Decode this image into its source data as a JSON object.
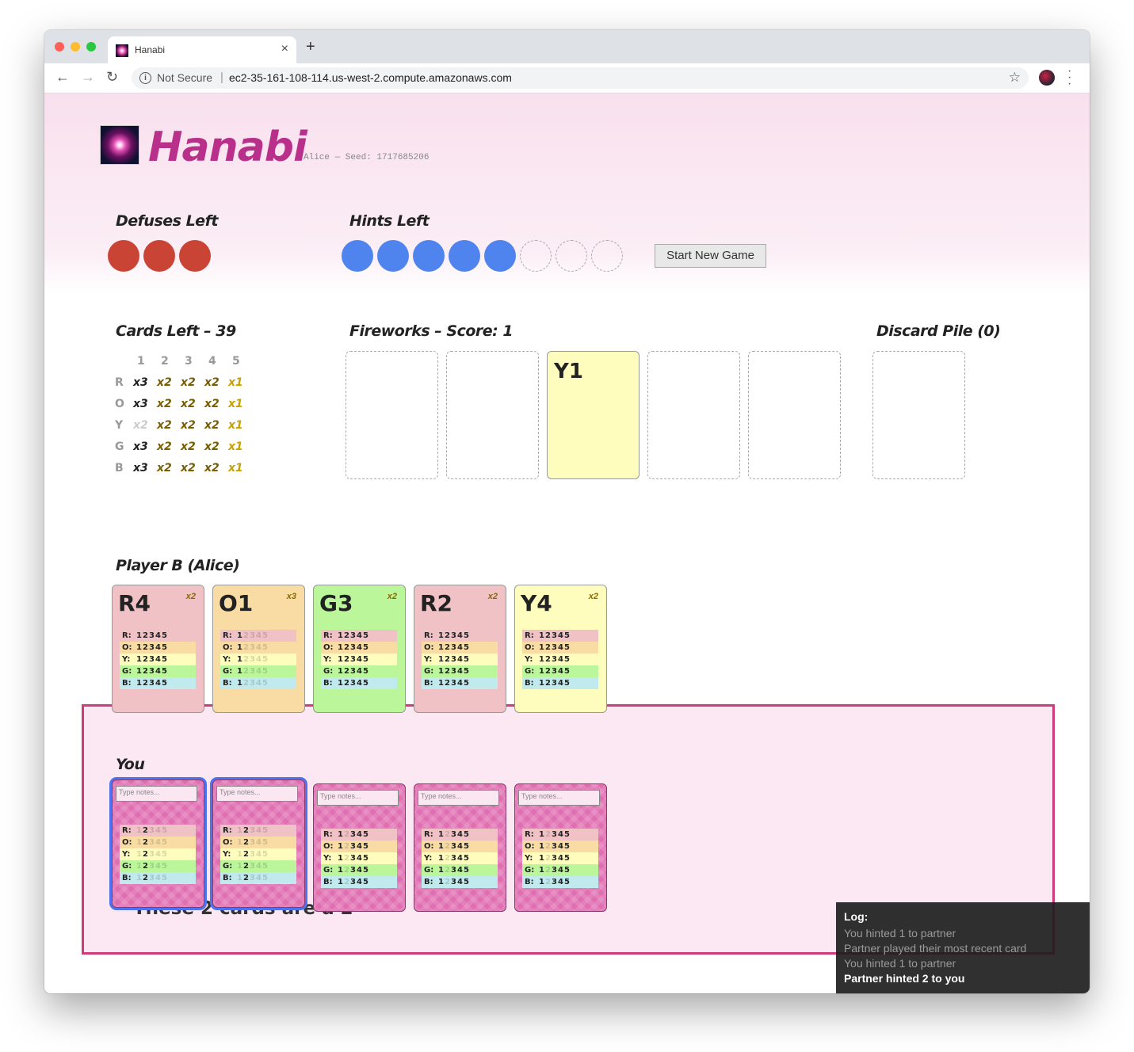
{
  "browser": {
    "tab_title": "Hanabi",
    "security": "Not Secure",
    "url": "ec2-35-161-108-114.us-west-2.compute.amazonaws.com"
  },
  "header": {
    "title": "Hanabi",
    "seed": "Alice — Seed: 1717685206"
  },
  "defuses": {
    "heading": "Defuses Left",
    "remaining": 3
  },
  "hints": {
    "heading": "Hints Left",
    "remaining": 5,
    "total": 8
  },
  "new_game_label": "Start New Game",
  "cards_left": {
    "heading": "Cards Left – 39",
    "columns": [
      "1",
      "2",
      "3",
      "4",
      "5"
    ],
    "rows": [
      {
        "label": "R",
        "counts": [
          "x3",
          "x2",
          "x2",
          "x2",
          "x1"
        ],
        "first_dim": false
      },
      {
        "label": "O",
        "counts": [
          "x3",
          "x2",
          "x2",
          "x2",
          "x1"
        ],
        "first_dim": false
      },
      {
        "label": "Y",
        "counts": [
          "x2",
          "x2",
          "x2",
          "x2",
          "x1"
        ],
        "first_dim": true
      },
      {
        "label": "G",
        "counts": [
          "x3",
          "x2",
          "x2",
          "x2",
          "x1"
        ],
        "first_dim": false
      },
      {
        "label": "B",
        "counts": [
          "x3",
          "x2",
          "x2",
          "x2",
          "x1"
        ],
        "first_dim": false
      }
    ]
  },
  "fireworks": {
    "heading": "Fireworks – Score: 1",
    "played_label": "Y1"
  },
  "discard": {
    "heading": "Discard Pile (0)"
  },
  "partner": {
    "heading": "Player B (Alice)",
    "cards": [
      {
        "label": "R4",
        "count": "x2",
        "color": "red",
        "allowed": "12345"
      },
      {
        "label": "O1",
        "count": "x3",
        "color": "orange",
        "allowed": "1"
      },
      {
        "label": "G3",
        "count": "x2",
        "color": "green",
        "allowed": "12345"
      },
      {
        "label": "R2",
        "count": "x2",
        "color": "red",
        "allowed": "12345"
      },
      {
        "label": "Y4",
        "count": "x2",
        "color": "yellow",
        "allowed": "12345"
      }
    ]
  },
  "possibility_labels": [
    "R:",
    "O:",
    "Y:",
    "G:",
    "B:"
  ],
  "you": {
    "heading": "You",
    "notes_placeholder": "Type notes...",
    "cards": [
      {
        "allowed": "2",
        "selected": true
      },
      {
        "allowed": "2",
        "selected": true
      },
      {
        "allowed": "1345",
        "selected": false
      },
      {
        "allowed": "1345",
        "selected": false
      },
      {
        "allowed": "1345",
        "selected": false
      }
    ],
    "quote": "\"These 2 cards are a 2\""
  },
  "log": {
    "title": "Log:",
    "entries": [
      "You hinted 1 to partner",
      "Partner played their most recent card",
      "You hinted 1 to partner",
      "Partner hinted 2 to you"
    ]
  },
  "colors": {
    "accent": "#b8308a",
    "defuse": "#c94434",
    "hint": "#4f84ef",
    "you_border": "#cf3c7d",
    "selected_border": "#4f72ef"
  }
}
